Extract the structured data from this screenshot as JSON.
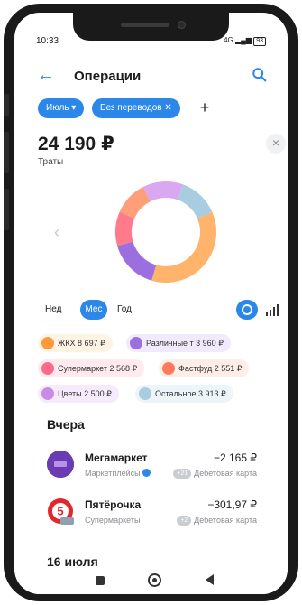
{
  "status_bar": {
    "time": "10:33",
    "signal": "4G",
    "battery": "93"
  },
  "header": {
    "title": "Операции",
    "back_icon": "arrow-left-icon",
    "search_icon": "search-icon"
  },
  "filters": {
    "month": "Июль ▾",
    "transfers": "Без переводов ✕",
    "add": "+"
  },
  "summary": {
    "amount": "24 190 ₽",
    "label": "Траты",
    "close": "×"
  },
  "donut": {
    "segments": [
      {
        "color": "#a8cde0",
        "share": 0.13
      },
      {
        "color": "#ffb36b",
        "share": 0.36
      },
      {
        "color": "#9b6fe0",
        "share": 0.16
      },
      {
        "color": "#ff7a8a",
        "share": 0.11
      },
      {
        "color": "#ff9f7a",
        "share": 0.11
      },
      {
        "color": "#d9a8f0",
        "share": 0.13
      }
    ]
  },
  "period": {
    "week": "Нед",
    "month": "Мес",
    "year": "Год"
  },
  "categories": [
    {
      "label": "ЖКХ 8 697 ₽",
      "color": "#ff9a3a",
      "bg": "#fff3e5"
    },
    {
      "label": "Различные т 3 960 ₽",
      "color": "#9b6fe0",
      "bg": "#f1eafd"
    },
    {
      "label": "Супермаркет 2 568 ₽",
      "color": "#ff6a8a",
      "bg": "#ffeaf0"
    },
    {
      "label": "Фастфуд 2 551 ₽",
      "color": "#ff7a5c",
      "bg": "#ffeee8"
    },
    {
      "label": "Цветы 2 500 ₽",
      "color": "#c98be8",
      "bg": "#f6ebfc"
    },
    {
      "label": "Остальное 3 913 ₽",
      "color": "#a8cde0",
      "bg": "#edf5fa"
    }
  ],
  "sections": {
    "yesterday": "Вчера",
    "date": "16 июля"
  },
  "transactions": [
    {
      "name": "Мегамаркет",
      "category": "Маркетплейсы",
      "amount": "−2 165 ₽",
      "badge": "+21",
      "card": "Дебетовая карта"
    },
    {
      "name": "Пятёрочка",
      "category": "Супермаркеты",
      "amount": "−301,97 ₽",
      "badge": "+2",
      "card": "Дебетовая карта"
    }
  ]
}
